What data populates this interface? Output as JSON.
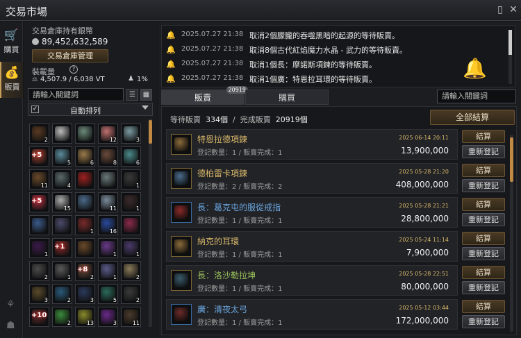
{
  "window": {
    "title": "交易市場"
  },
  "left_tabs": [
    {
      "label": "購買",
      "icon": "cart-icon"
    },
    {
      "label": "販賣",
      "icon": "bag-icon"
    }
  ],
  "inventory": {
    "silver_label": "交易倉庫持有銀幣",
    "silver_amount": "89,452,632,589",
    "manage_button": "交易倉庫管理",
    "weight_label": "裝載量",
    "weight_value": "4,507.9 / 6,038 VT",
    "weight_pct": "1%",
    "search_placeholder": "請輸入關鍵詞",
    "sort_label": "自動排列",
    "sort_checked": true,
    "items": [
      {
        "c": "#5a3a22",
        "n": "2"
      },
      {
        "c": "#bcbcbc",
        "n": ""
      },
      {
        "c": "#6a8a7a",
        "n": ""
      },
      {
        "c": "#c07070",
        "n": "12"
      },
      {
        "c": "#7a9aa0",
        "n": "3"
      },
      {
        "c": "#a04030",
        "n": "",
        "p": "+5"
      },
      {
        "c": "#5a8a9a",
        "n": "5"
      },
      {
        "c": "#9a7a4a",
        "n": "6"
      },
      {
        "c": "#6a4a3a",
        "n": "8"
      },
      {
        "c": "#4a8a8a",
        "n": "6"
      },
      {
        "c": "#6a4a2a",
        "n": "11"
      },
      {
        "c": "#5a6a6a",
        "n": "4"
      },
      {
        "c": "#a02020",
        "n": ""
      },
      {
        "c": "#6a7a7a",
        "n": ""
      },
      {
        "c": "#3a3a3a",
        "n": "1"
      },
      {
        "c": "#b03040",
        "n": "",
        "p": "+5"
      },
      {
        "c": "#aaaaaa",
        "n": "15"
      },
      {
        "c": "#4a6a8a",
        "n": ""
      },
      {
        "c": "#7a8a9a",
        "n": "11"
      },
      {
        "c": "#3a2a2a",
        "n": "1"
      },
      {
        "c": "#3a5a8a",
        "n": ""
      },
      {
        "c": "#4a4a6a",
        "n": ""
      },
      {
        "c": "#7a2a2a",
        "n": "1"
      },
      {
        "c": "#2a4a9a",
        "n": "16"
      },
      {
        "c": "#8a2a4a",
        "n": ""
      },
      {
        "c": "#3a1a4a",
        "n": "1"
      },
      {
        "c": "#8a2a2a",
        "n": "",
        "p": "+1"
      },
      {
        "c": "#6a4a2a",
        "n": ""
      },
      {
        "c": "#6a3a8a",
        "n": "1"
      },
      {
        "c": "#4a3a6a",
        "n": "1"
      },
      {
        "c": "#4a4a4a",
        "n": "2"
      },
      {
        "c": "#5a5a5a",
        "n": "1"
      },
      {
        "c": "#6a4a3a",
        "n": "2",
        "p": "+8"
      },
      {
        "c": "#5a5a8a",
        "n": "1"
      },
      {
        "c": "#8a7a5a",
        "n": "2"
      },
      {
        "c": "#5a4a2a",
        "n": "3"
      },
      {
        "c": "#2a5a7a",
        "n": "2"
      },
      {
        "c": "#2a3a5a",
        "n": "3"
      },
      {
        "c": "#2a6a5a",
        "n": "5"
      },
      {
        "c": "#3a3a3a",
        "n": "2"
      },
      {
        "c": "#6a2a2a",
        "n": "",
        "p": "+10"
      },
      {
        "c": "#3a8a3a",
        "n": "2"
      },
      {
        "c": "#8a8a2a",
        "n": "13"
      },
      {
        "c": "#6a2a8a",
        "n": "3"
      },
      {
        "c": "#4a3a2a",
        "n": "11"
      }
    ]
  },
  "log": [
    {
      "time": "2025.07.27 21:38",
      "msg": "取消2個朦朧的吞噬黑暗的起源的等待販賣。"
    },
    {
      "time": "2025.07.27 21:38",
      "msg": "取消8個古代紅焰魔力水晶 - 武力的等待販賣。"
    },
    {
      "time": "2025.07.27 21:38",
      "msg": "取消1個長：摩諾斯項鍊的等待販賣。"
    },
    {
      "time": "2025.07.27 21:38",
      "msg": "取消1個廣：特恩拉耳環的等待販賣。"
    }
  ],
  "tabs": {
    "sell": "販賣",
    "sell_badge": "20919",
    "buy": "購買"
  },
  "right_search_placeholder": "請輸入關鍵詞",
  "summary": {
    "pending_label": "等待販賣",
    "pending_value": "334個",
    "done_label": "完成販賣",
    "done_value": "20919個",
    "separator": "/",
    "settle_all": "全部結算"
  },
  "orders": [
    {
      "name": "特恩拉德項鍊",
      "name_color": "#d9b86a",
      "reg": "登記數量：1 / 販賣完成：1",
      "date": "2025 06-14 20:11",
      "price": "13,900,000",
      "icon": "#8a6a3a",
      "frame": "gold"
    },
    {
      "name": "德柏雷卡項鍊",
      "name_color": "#d9b86a",
      "reg": "登記數量：2 / 販賣完成：2",
      "date": "2025 05-28 21:20",
      "price": "408,000,000",
      "icon": "#4a6a8a",
      "frame": "gold"
    },
    {
      "name": "長：葛克屯的服從戒指",
      "name_color": "#6aa6e0",
      "reg": "登記數量：1 / 販賣完成：1",
      "date": "2025 05-28 21:21",
      "price": "28,800,000",
      "icon": "#8a2a2a",
      "frame": "blue"
    },
    {
      "name": "納克的耳環",
      "name_color": "#d9b86a",
      "reg": "登記數量：1 / 販賣完成：1",
      "date": "2025 05-24 11:14",
      "price": "7,900,000",
      "icon": "#8a6a3a",
      "frame": "gold"
    },
    {
      "name": "長：洛沙勒拉坤",
      "name_color": "#9ac05a",
      "reg": "登記數量：1 / 販賣完成：1",
      "date": "2025 05-28 22:51",
      "price": "80,000,000",
      "icon": "#3a5a6a",
      "frame": "gold"
    },
    {
      "name": "廣：清夜太弓",
      "name_color": "#6aa6e0",
      "reg": "登記數量：1 / 販賣完成：1",
      "date": "2025 05-12 03:44",
      "price": "172,000,000",
      "icon": "#6a2a2a",
      "frame": "blue"
    }
  ],
  "order_buttons": {
    "settle": "結算",
    "relist": "重新登記"
  }
}
